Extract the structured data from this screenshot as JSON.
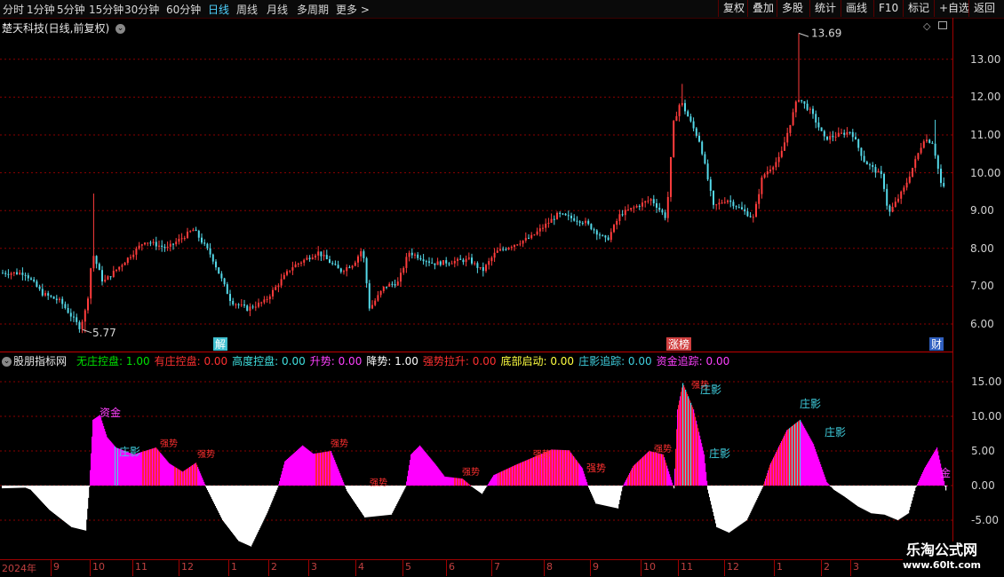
{
  "toolbar": {
    "periods": [
      "分时",
      "1分钟",
      "5分钟",
      "15分钟",
      "30分钟",
      "60分钟",
      "日线",
      "周线",
      "月线",
      "多周期",
      "更多 >"
    ],
    "active_period": "日线",
    "right_buttons": [
      "复权",
      "叠加",
      "多股",
      "统计",
      "画线",
      "F10",
      "标记",
      "+自选",
      "返回"
    ]
  },
  "main_chart": {
    "title": "楚天科技(日线,前复权)",
    "y_ticks": [
      "13.00",
      "12.00",
      "11.00",
      "10.00",
      "9.00",
      "8.00",
      "7.00",
      "6.00"
    ],
    "high_label": "13.69",
    "low_label": "5.77",
    "event_markers": [
      "解",
      "涨榜",
      "财"
    ]
  },
  "indicator": {
    "title": "股朋指标网",
    "legend": [
      {
        "label": "无庄控盘:",
        "value": "1.00",
        "color": "#00e000"
      },
      {
        "label": "有庄控盘:",
        "value": "0.00",
        "color": "#ff3030"
      },
      {
        "label": "高度控盘:",
        "value": "0.00",
        "color": "#40e0e0"
      },
      {
        "label": "升势:",
        "value": "0.00",
        "color": "#ff40ff"
      },
      {
        "label": "降势:",
        "value": "1.00",
        "color": "#ffffff"
      },
      {
        "label": "强势拉升:",
        "value": "0.00",
        "color": "#ff3030"
      },
      {
        "label": "底部启动:",
        "value": "0.00",
        "color": "#ffff40"
      },
      {
        "label": "庄影追踪:",
        "value": "0.00",
        "color": "#40d0e0"
      },
      {
        "label": "资金追踪:",
        "value": "0.00",
        "color": "#ff40ff"
      }
    ],
    "y_ticks": [
      "15.00",
      "10.00",
      "5.00",
      "0.00",
      "-5.00"
    ],
    "labels": {
      "zijin": "资金",
      "zhuangying": "庄影",
      "qiangshi": "强势",
      "jin": "金"
    }
  },
  "date_axis": [
    "2024年",
    "9",
    "10",
    "11",
    "12",
    "1",
    "2",
    "3",
    "4",
    "5",
    "6",
    "7",
    "8",
    "9",
    "10",
    "11",
    "12",
    "1",
    "2",
    "3"
  ],
  "watermark": {
    "title": "乐淘公式网",
    "url": "www.60lt.com"
  },
  "colors": {
    "up": "#ff3c3c",
    "down": "#54d8e8",
    "bar_pos": "#ff00ff",
    "bar_neg": "#ffffff",
    "grid": "#8a0000"
  }
}
